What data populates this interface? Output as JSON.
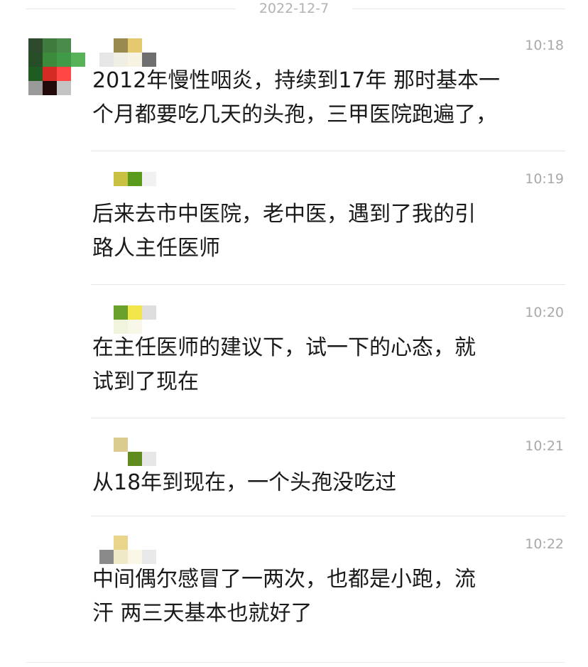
{
  "date_divider": "2022-12-7",
  "avatar": {
    "colors": [
      [
        "#2e4a2e",
        "#3f7a3f",
        "#4a8a4a",
        "#ffffff"
      ],
      [
        "#274e27",
        "#3c8b3c",
        "#3f9b48",
        "#58b25a"
      ],
      [
        "#1f5c22",
        "#d62a24",
        "#ff4545",
        "#ffffff"
      ],
      [
        "#9a9a9a",
        "#220a0a",
        "#c3c3c3",
        "#ffffff"
      ]
    ]
  },
  "messages": [
    {
      "time": "10:18",
      "text": "2012年慢性咽炎，持续到17年 那时基本一\n个月都要吃几天的头孢，三甲医院跑遍了，",
      "name_colors": [
        [
          "#ffffff",
          "#9b8a50",
          "#e5c96f",
          "#ffffff"
        ],
        [
          "#e6e6e6",
          "#f1efe4",
          "#f6f3e3",
          "#6e6e6e"
        ]
      ]
    },
    {
      "time": "10:19",
      "text": "后来去市中医院，老中医，遇到了我的引\n路人主任医师",
      "name_colors": [
        [
          "#ffffff",
          "#c8c040",
          "#5a9b1e",
          "#f1f1f1"
        ],
        [
          "#ffffff",
          "#ffffff",
          "#ffffff",
          "#ffffff"
        ]
      ]
    },
    {
      "time": "10:20",
      "text": "在主任医师的建议下，试一下的心态，就\n试到了现在",
      "name_colors": [
        [
          "#ffffff",
          "#6aa12a",
          "#f0e64a",
          "#dedede"
        ],
        [
          "#ffffff",
          "#f0f4dc",
          "#f7f6e7",
          "#ffffff"
        ]
      ]
    },
    {
      "time": "10:21",
      "text": "从18年到现在，一个头孢没吃过",
      "name_colors": [
        [
          "#ffffff",
          "#dccb8f",
          "#ffffff",
          "#ffffff"
        ],
        [
          "#ffffff",
          "#ffffff",
          "#5f8c1d",
          "#e6e6e6"
        ]
      ]
    },
    {
      "time": "10:22",
      "text": "中间偶尔感冒了一两次，也都是小跑，流\n汗 两三天基本也就好了",
      "name_colors": [
        [
          "#ffffff",
          "#e8d48a",
          "#ffffff",
          "#ffffff"
        ],
        [
          "#8a8a8a",
          "#efe9c8",
          "#faf6e6",
          "#e9e9e9"
        ]
      ]
    }
  ]
}
